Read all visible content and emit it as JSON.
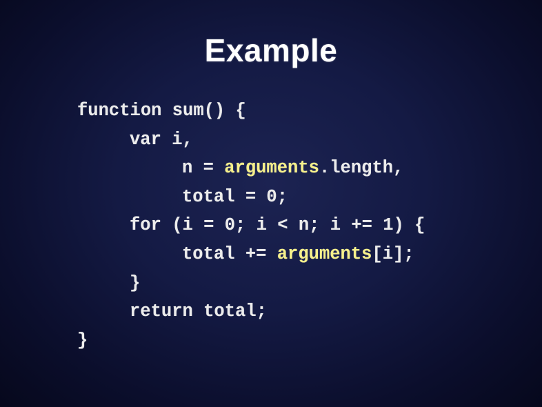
{
  "slide": {
    "title": "Example",
    "accent_color": "#f6f08a",
    "code_lines": [
      {
        "indent": 0,
        "segments": [
          {
            "text": "function sum() {",
            "highlight": false
          }
        ]
      },
      {
        "indent": 1,
        "segments": [
          {
            "text": "var i,",
            "highlight": false
          }
        ]
      },
      {
        "indent": 2,
        "segments": [
          {
            "text": "n = ",
            "highlight": false
          },
          {
            "text": "arguments",
            "highlight": true
          },
          {
            "text": ".length,",
            "highlight": false
          }
        ]
      },
      {
        "indent": 2,
        "segments": [
          {
            "text": "total = 0;",
            "highlight": false
          }
        ]
      },
      {
        "indent": 1,
        "segments": [
          {
            "text": "for (i = 0; i < n; i += 1) {",
            "highlight": false
          }
        ]
      },
      {
        "indent": 2,
        "segments": [
          {
            "text": "total += ",
            "highlight": false
          },
          {
            "text": "arguments",
            "highlight": true
          },
          {
            "text": "[i];",
            "highlight": false
          }
        ]
      },
      {
        "indent": 1,
        "segments": [
          {
            "text": "}",
            "highlight": false
          }
        ]
      },
      {
        "indent": 1,
        "segments": [
          {
            "text": "return total;",
            "highlight": false
          }
        ]
      },
      {
        "indent": 0,
        "segments": [
          {
            "text": "}",
            "highlight": false
          }
        ]
      }
    ]
  }
}
